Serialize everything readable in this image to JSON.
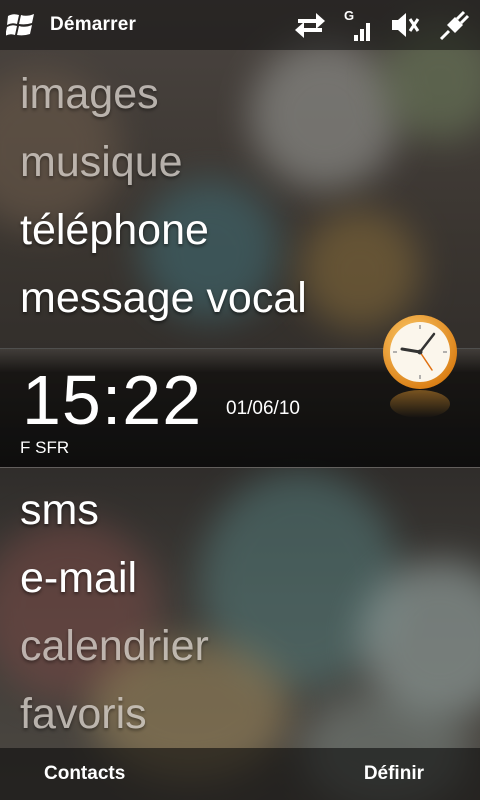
{
  "topbar": {
    "start_label": "Démarrer",
    "icons": [
      "windows-logo-icon",
      "data-sync-icon",
      "signal-g-icon",
      "speaker-muted-icon",
      "power-plug-icon"
    ]
  },
  "menu_top": [
    "images",
    "musique",
    "téléphone",
    "message vocal"
  ],
  "clock": {
    "time": "15:22",
    "date": "01/06/10",
    "operator": "F SFR"
  },
  "menu_bottom": [
    "sms",
    "e-mail",
    "calendrier",
    "favoris"
  ],
  "softkeys": {
    "left": "Contacts",
    "right": "Définir"
  },
  "colors": {
    "clock_face": "#f0a030",
    "background": "#2a2622"
  }
}
